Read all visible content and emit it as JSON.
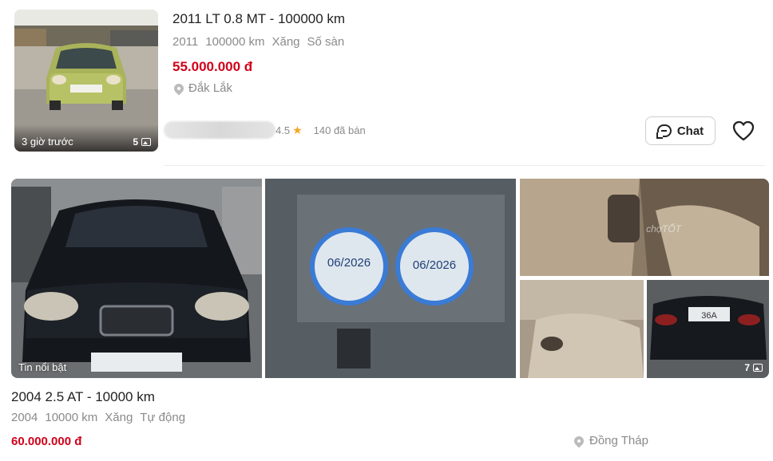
{
  "listing1": {
    "title": "2011 LT 0.8 MT - 100000 km",
    "specs": [
      "2011",
      "100000 km",
      "Xăng",
      "Số sàn"
    ],
    "price": "55.000.000 đ",
    "location": "Đắk Lắk",
    "thumbnail": {
      "time_label": "3 giờ trước",
      "image_count": "5"
    },
    "seller": {
      "rating": "4.5",
      "sold_label": "140 đã bán"
    },
    "chat_label": "Chat"
  },
  "listing2": {
    "title": "2004 2.5 AT - 10000 km",
    "specs": [
      "2004",
      "10000 km",
      "Xăng",
      "Tự động"
    ],
    "price": "60.000.000 đ",
    "location": "Đồng Tháp",
    "gallery": {
      "badge": "Tin nổi bật",
      "image_count": "7",
      "sticker_dates": [
        "06/2026",
        "06/2026"
      ],
      "watermark": "chợTỐT",
      "plate_fragment": "36A"
    }
  },
  "colors": {
    "price_red": "#d0021b",
    "star": "#f5a623",
    "muted_text": "#8a8a8a"
  },
  "icons": [
    "image-count-icon",
    "location-pin-icon",
    "star-icon",
    "chat-icon",
    "heart-icon"
  ]
}
